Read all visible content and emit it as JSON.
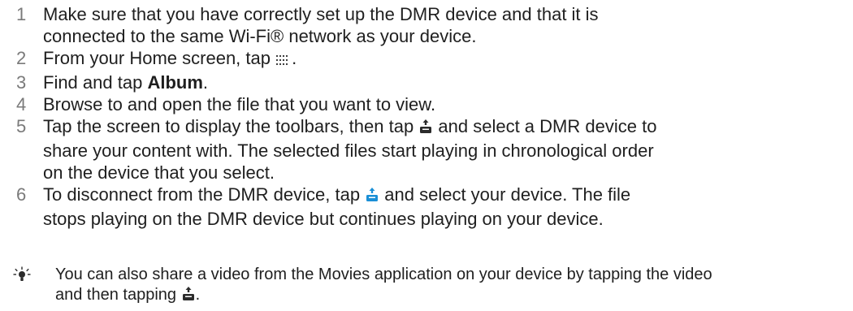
{
  "steps": [
    {
      "number": "1",
      "line1": "Make sure that you have correctly set up the DMR device and that it is",
      "line2": "connected to the same Wi-Fi® network as your device."
    },
    {
      "number": "2",
      "before": "From your Home screen, tap ",
      "after": ".",
      "icon": "apps-grid-icon"
    },
    {
      "number": "3",
      "before": "Find and tap ",
      "bold": "Album",
      "after": "."
    },
    {
      "number": "4",
      "text": "Browse to and open the file that you want to view."
    },
    {
      "number": "5",
      "line1_before": "Tap the screen to display the toolbars, then tap ",
      "line1_after": " and select a DMR device to",
      "line2": "share your content with. The selected files start playing in chronological order",
      "line3": "on the device that you select.",
      "icon": "share-screen-icon"
    },
    {
      "number": "6",
      "line1_before": "To disconnect from the DMR device, tap ",
      "line1_after": " and select your device. The file",
      "line2": "stops playing on the DMR device but continues playing on your device.",
      "icon": "share-screen-active-icon"
    }
  ],
  "tip": {
    "icon": "lightbulb-tip-icon",
    "line1": "You can also share a video from the Movies application on your device by tapping the video",
    "line2_before": "and then tapping ",
    "line2_after": ".",
    "inline_icon": "share-screen-icon"
  },
  "colors": {
    "text": "#1f1f1f",
    "step_number": "#7a7a7a",
    "icon_dark": "#2b2b2b",
    "icon_active": "#1a8fd6"
  }
}
